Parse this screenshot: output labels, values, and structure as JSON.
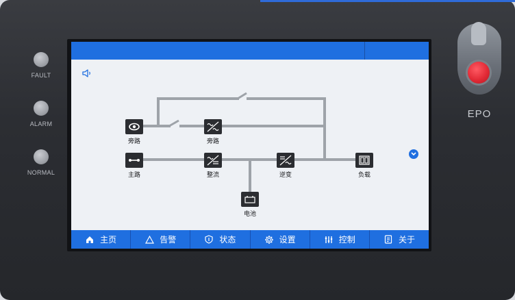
{
  "panel": {
    "leds": [
      {
        "label": "FAULT"
      },
      {
        "label": "ALARM"
      },
      {
        "label": "NORMAL"
      }
    ],
    "epo_label": "EPO"
  },
  "screen": {
    "colors": {
      "accent": "#1f6fe0",
      "background": "#eef1f5",
      "line": "#9ea3a9",
      "icon": "#2b2d31"
    },
    "sound_icon": "speaker-icon",
    "diagram": {
      "nodes": [
        {
          "id": "bypass-input",
          "label": "旁路",
          "icon": "bypass-input-icon"
        },
        {
          "id": "bypass-switch",
          "label": "旁路",
          "icon": "bypass-static-switch-icon"
        },
        {
          "id": "main-input",
          "label": "主路",
          "icon": "main-input-icon"
        },
        {
          "id": "rectifier",
          "label": "整流",
          "icon": "rectifier-icon"
        },
        {
          "id": "inverter",
          "label": "逆变",
          "icon": "inverter-icon"
        },
        {
          "id": "load",
          "label": "负载",
          "icon": "load-icon"
        },
        {
          "id": "battery",
          "label": "电池",
          "icon": "battery-icon"
        }
      ]
    },
    "nav": [
      {
        "label": "主页",
        "icon": "home-icon"
      },
      {
        "label": "告警",
        "icon": "warning-icon"
      },
      {
        "label": "状态",
        "icon": "shield-icon"
      },
      {
        "label": "设置",
        "icon": "gear-icon"
      },
      {
        "label": "控制",
        "icon": "control-icon"
      },
      {
        "label": "关于",
        "icon": "info-doc-icon"
      }
    ]
  }
}
